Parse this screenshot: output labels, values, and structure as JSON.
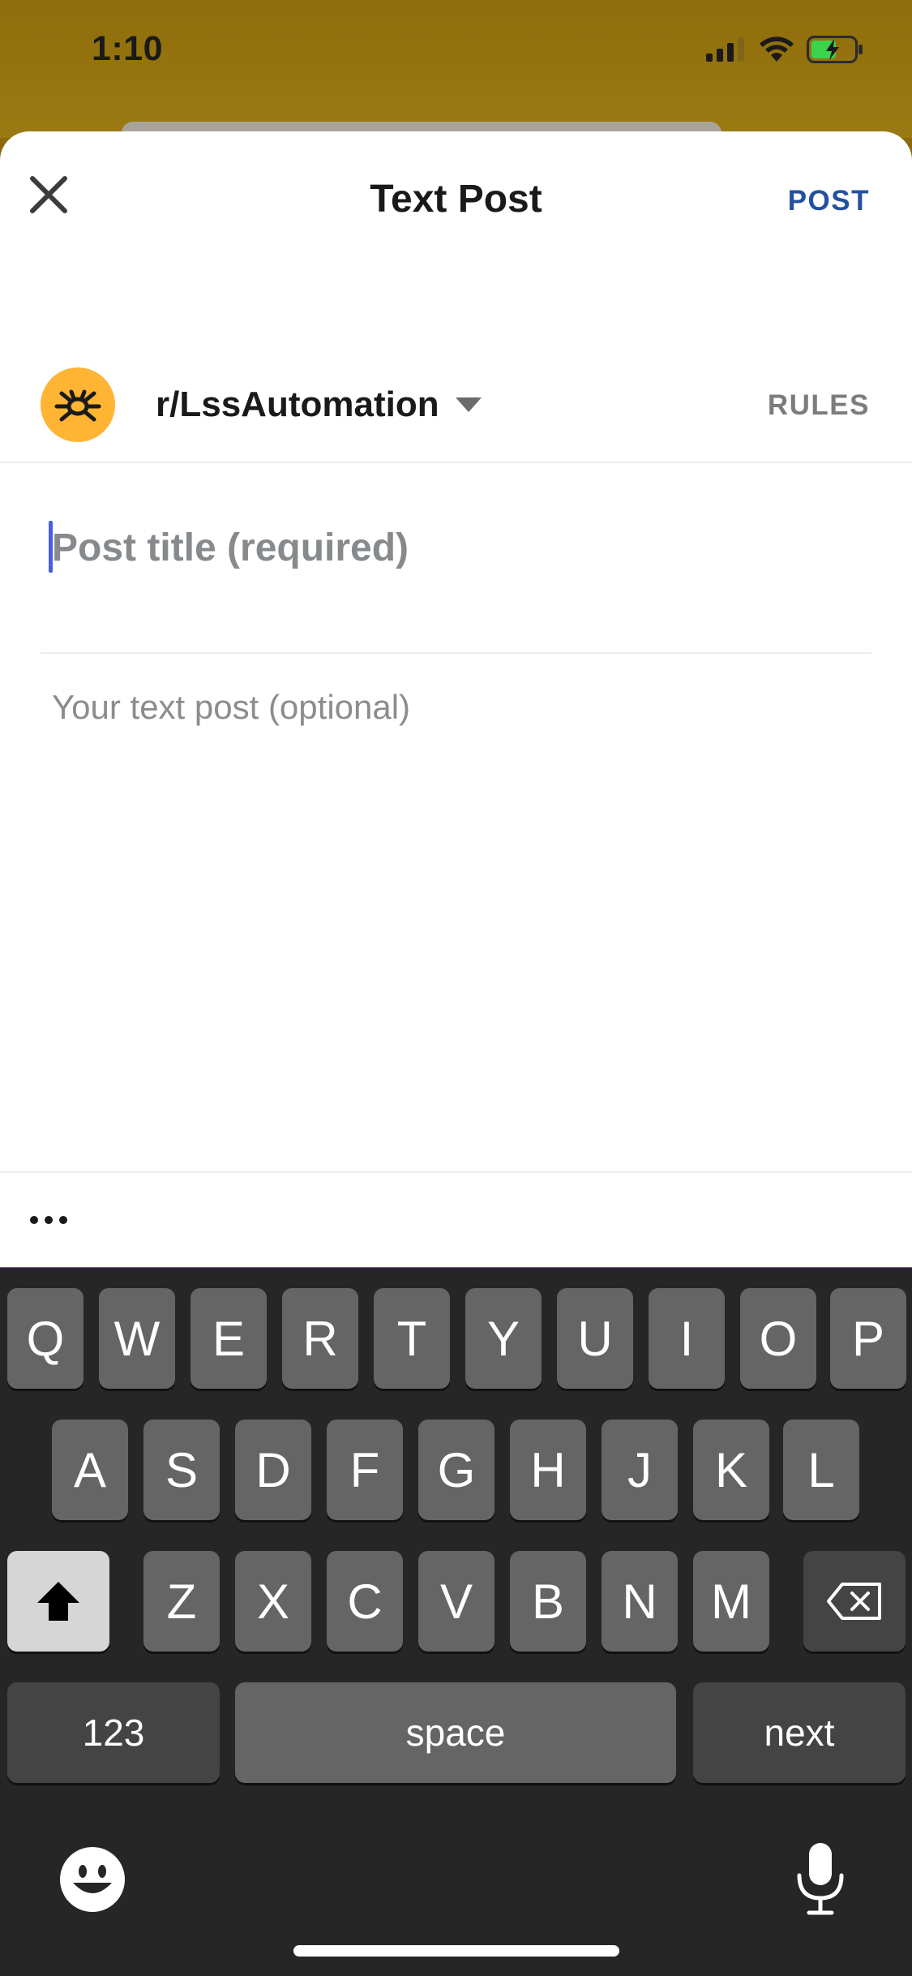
{
  "status_bar": {
    "time": "1:10",
    "icons": [
      "cellular-signal-icon",
      "wifi-icon",
      "battery-charging-icon"
    ]
  },
  "header": {
    "title": "Text Post",
    "post_label": "POST",
    "close_icon": "close-icon"
  },
  "community": {
    "name": "r/LssAutomation",
    "rules_label": "RULES",
    "avatar_icon": "bug-icon",
    "caret_icon": "caret-down-icon"
  },
  "form": {
    "title_placeholder": "Post title (required)",
    "title_value": "",
    "body_placeholder": "Your text post (optional)",
    "body_value": ""
  },
  "toolbar": {
    "more_icon": "more-horizontal-icon"
  },
  "keyboard": {
    "row1": [
      "Q",
      "W",
      "E",
      "R",
      "T",
      "Y",
      "U",
      "I",
      "O",
      "P"
    ],
    "row2": [
      "A",
      "S",
      "D",
      "F",
      "G",
      "H",
      "J",
      "K",
      "L"
    ],
    "row3": [
      "Z",
      "X",
      "C",
      "V",
      "B",
      "N",
      "M"
    ],
    "numbers_label": "123",
    "space_label": "space",
    "return_label": "next",
    "shift_icon": "shift-icon",
    "delete_icon": "backspace-icon",
    "emoji_icon": "emoji-icon",
    "mic_icon": "microphone-icon"
  },
  "colors": {
    "accent_blue": "#24519e",
    "avatar_orange": "#ffb433",
    "cursor": "#4a5fe0",
    "keyboard_bg": "#262626",
    "key_bg": "#656565"
  }
}
